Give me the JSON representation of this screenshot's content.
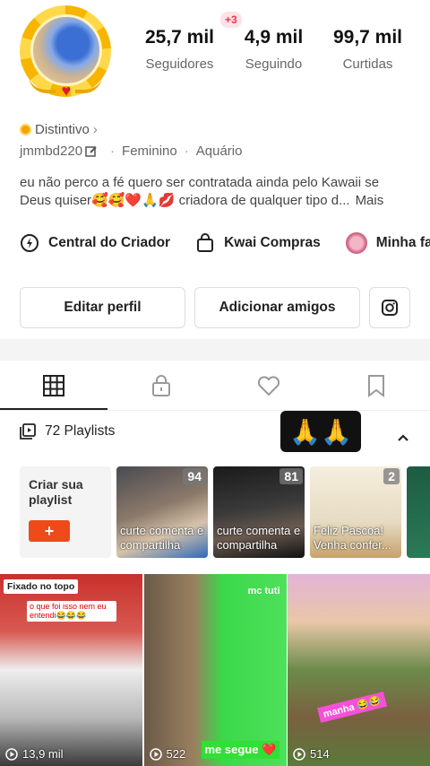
{
  "profile": {
    "new_badge": "+3",
    "stats": [
      {
        "value": "25,7 mil",
        "label": "Seguidores"
      },
      {
        "value": "4,9 mil",
        "label": "Seguindo"
      },
      {
        "value": "99,7 mil",
        "label": "Curtidas"
      }
    ],
    "distintivo_label": "Distintivo",
    "username": "jmmbd220",
    "gender": "Feminino",
    "sign": "Aquário",
    "bio": "eu não perco a fé quero ser contratada ainda pelo Kawaii se Deus quiser🥰🥰❤️🙏💋 criadora de qualquer tipo d...",
    "bio_more": "Mais"
  },
  "shortcuts": [
    {
      "label": "Central do Criador",
      "icon": "creator-center-icon"
    },
    {
      "label": "Kwai Compras",
      "icon": "shopping-bag-icon"
    },
    {
      "label": "Minha fa",
      "icon": "fan-avatar-icon"
    }
  ],
  "buttons": {
    "edit": "Editar perfil",
    "add_friends": "Adicionar amigos",
    "instagram_icon": "instagram-icon"
  },
  "tabs": [
    {
      "icon": "grid-icon",
      "active": true
    },
    {
      "icon": "lock-icon",
      "active": false
    },
    {
      "icon": "heart-icon",
      "active": false
    },
    {
      "icon": "bookmark-icon",
      "active": false
    }
  ],
  "playlists": {
    "header": "72 Playlists",
    "emoji_banner": "🙏🙏",
    "create_label": "Criar sua playlist",
    "create_plus": "+",
    "cards": [
      {
        "count": "94",
        "caption": "curte comenta e compartilha"
      },
      {
        "count": "81",
        "caption": "curte comenta e compartilha"
      },
      {
        "count": "2",
        "caption": "Feliz Pascoa! Venha confer..."
      }
    ]
  },
  "videos": [
    {
      "pinned": "Fixado no topo",
      "overlay": "o que foi isso nem eu entendi😂😂😂",
      "views": "13,9 mil"
    },
    {
      "overlay": "mc tuti",
      "label": "me segue ❤️",
      "views": "522"
    },
    {
      "sticker": "manha 😂😂",
      "views": "514"
    }
  ],
  "colors": {
    "accent": "#ee4a1a",
    "badge_bg": "#fde3e6",
    "badge_text": "#e8384f",
    "green_label": "#31e034"
  }
}
